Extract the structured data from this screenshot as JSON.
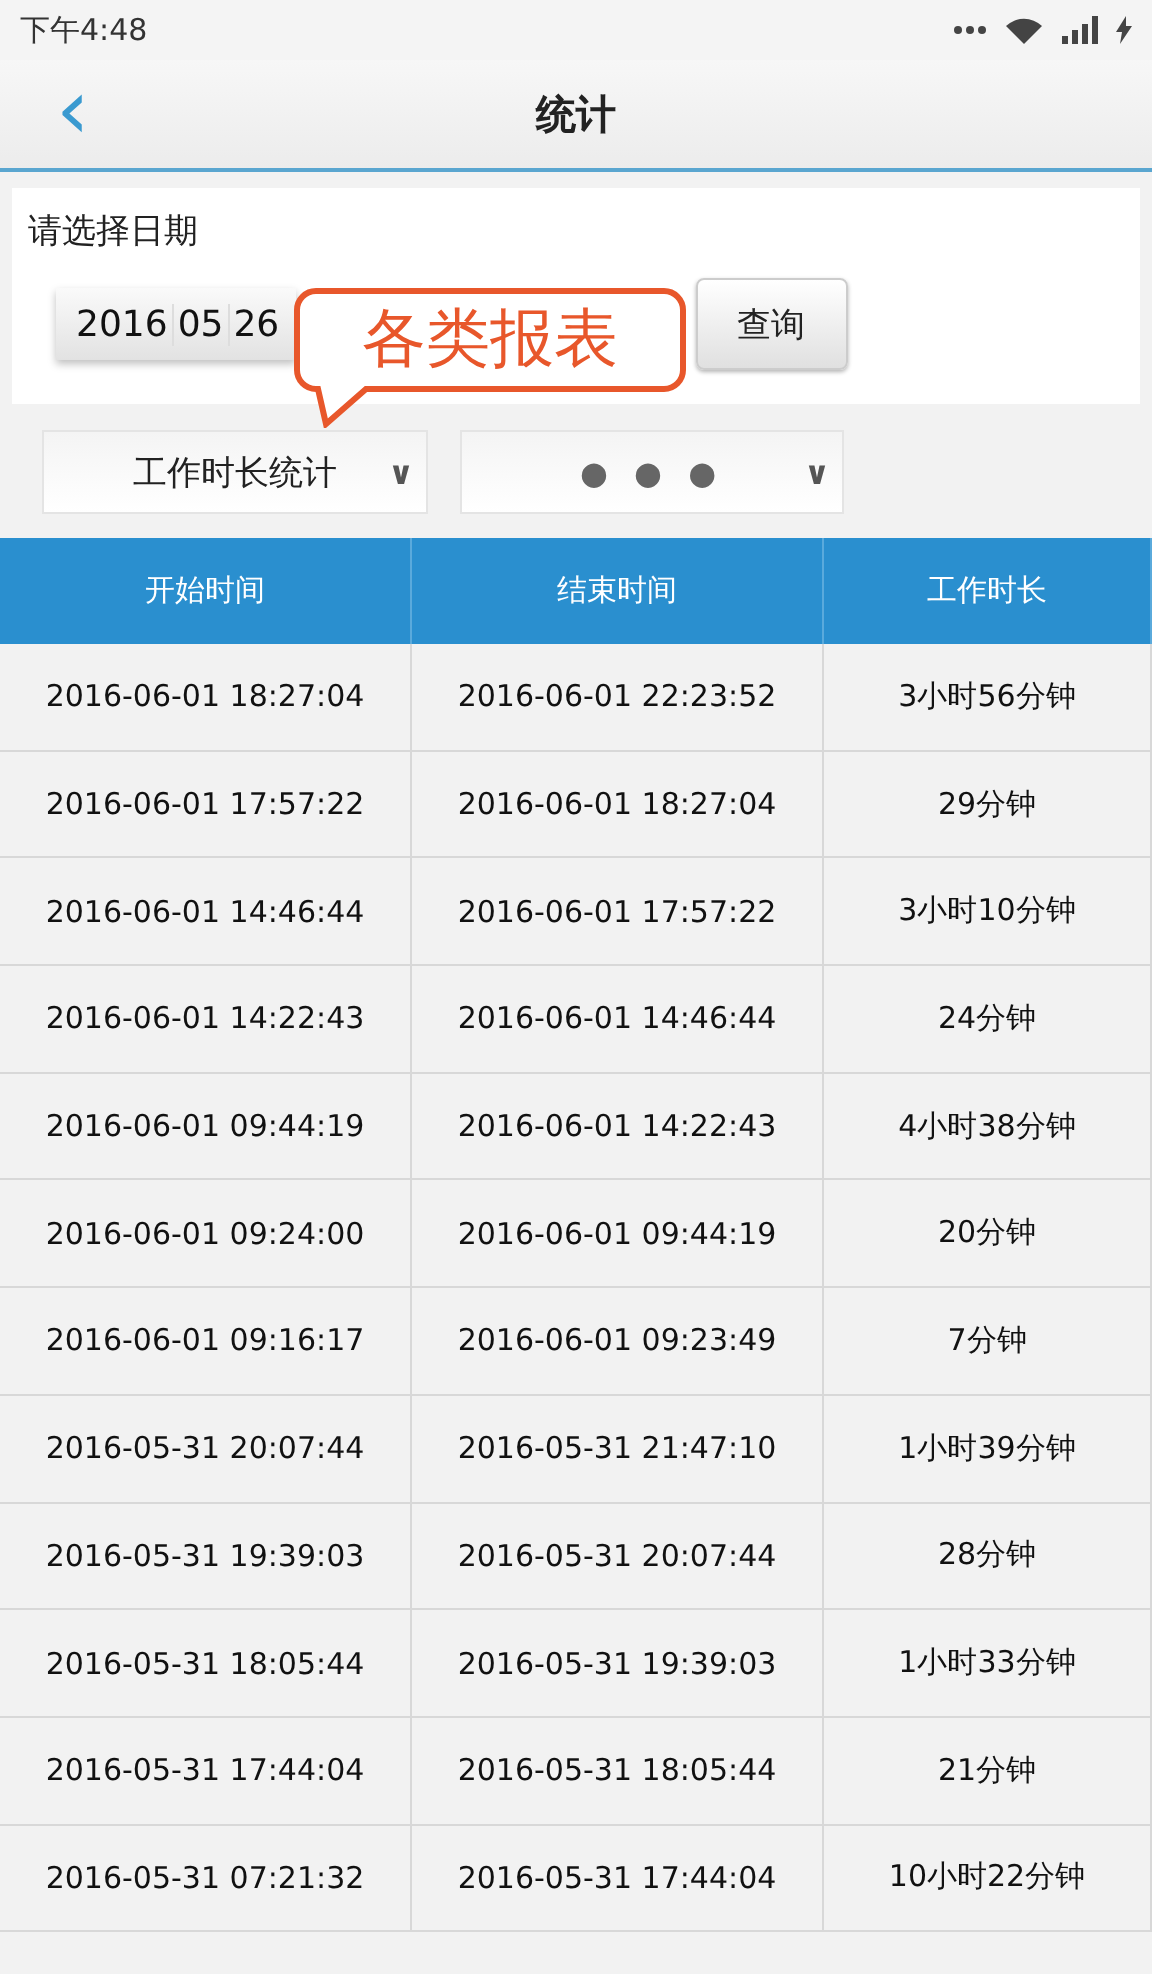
{
  "status_bar": {
    "time": "下午4:48"
  },
  "header": {
    "back": "‹",
    "title": "统计"
  },
  "date_panel": {
    "label": "请选择日期",
    "date": {
      "year": "2016",
      "month": "05",
      "day": "26"
    },
    "query_button": "查询"
  },
  "callout": {
    "text": "各类报表"
  },
  "dropdowns": [
    {
      "value": "工作时长统计",
      "arrow": "∨"
    },
    {
      "value": "● ● ●",
      "arrow": "∨"
    }
  ],
  "table": {
    "columns": [
      "开始时间",
      "结束时间",
      "工作时长"
    ],
    "rows": [
      [
        "2016-06-01 18:27:04",
        "2016-06-01 22:23:52",
        "3小时56分钟"
      ],
      [
        "2016-06-01 17:57:22",
        "2016-06-01 18:27:04",
        "29分钟"
      ],
      [
        "2016-06-01 14:46:44",
        "2016-06-01 17:57:22",
        "3小时10分钟"
      ],
      [
        "2016-06-01 14:22:43",
        "2016-06-01 14:46:44",
        "24分钟"
      ],
      [
        "2016-06-01 09:44:19",
        "2016-06-01 14:22:43",
        "4小时38分钟"
      ],
      [
        "2016-06-01 09:24:00",
        "2016-06-01 09:44:19",
        "20分钟"
      ],
      [
        "2016-06-01 09:16:17",
        "2016-06-01 09:23:49",
        "7分钟"
      ],
      [
        "2016-05-31 20:07:44",
        "2016-05-31 21:47:10",
        "1小时39分钟"
      ],
      [
        "2016-05-31 19:39:03",
        "2016-05-31 20:07:44",
        "28分钟"
      ],
      [
        "2016-05-31 18:05:44",
        "2016-05-31 19:39:03",
        "1小时33分钟"
      ],
      [
        "2016-05-31 17:44:04",
        "2016-05-31 18:05:44",
        "21分钟"
      ],
      [
        "2016-05-31 07:21:32",
        "2016-05-31 17:44:04",
        "10小时22分钟"
      ]
    ]
  }
}
